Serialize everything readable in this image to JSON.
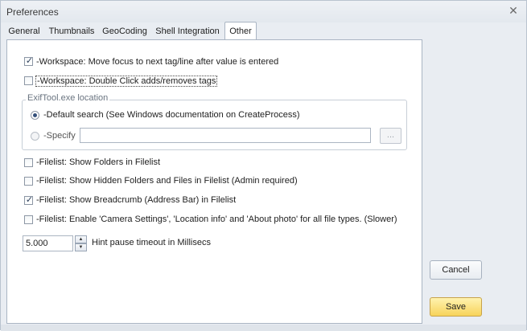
{
  "window": {
    "title": "Preferences"
  },
  "tabs": [
    {
      "label": "General",
      "active": false
    },
    {
      "label": "Thumbnails",
      "active": false
    },
    {
      "label": "GeoCoding",
      "active": false
    },
    {
      "label": "Shell Integration",
      "active": false
    },
    {
      "label": "Other",
      "active": true
    }
  ],
  "options": {
    "workspace_move_focus": {
      "label": "-Workspace: Move focus to next tag/line after value is entered",
      "checked": true
    },
    "workspace_double_click": {
      "label": "-Workspace: Double Click adds/removes tags",
      "checked": false
    },
    "exiftool_group": {
      "title": "ExifTool.exe location",
      "default_search": {
        "label": "-Default search (See Windows documentation on CreateProcess)",
        "selected": true
      },
      "specify": {
        "label": "-Specify",
        "selected": false
      },
      "path_value": "",
      "browse_label": "..."
    },
    "filelist_show_folders": {
      "label": "-Filelist: Show Folders in Filelist",
      "checked": false
    },
    "filelist_show_hidden": {
      "label": "-Filelist: Show Hidden Folders and Files in Filelist (Admin required)",
      "checked": false
    },
    "filelist_show_breadcrumb": {
      "label": "-Filelist: Show Breadcrumb (Address Bar) in Filelist",
      "checked": true
    },
    "filelist_camera_settings": {
      "label": "-Filelist: Enable 'Camera Settings', 'Location info' and 'About photo' for all file types. (Slower)",
      "checked": false
    },
    "hint_pause": {
      "value": "5.000",
      "label": "Hint pause timeout in Millisecs"
    }
  },
  "buttons": {
    "cancel": "Cancel",
    "save": "Save"
  },
  "icons": {
    "close": "close-icon",
    "check": "check-icon",
    "spin_up": "arrow-up-icon",
    "spin_down": "arrow-down-icon"
  },
  "colors": {
    "save_accent": "#f7d35a",
    "panel_bg": "#ffffff",
    "window_bg": "#e9edf2"
  }
}
